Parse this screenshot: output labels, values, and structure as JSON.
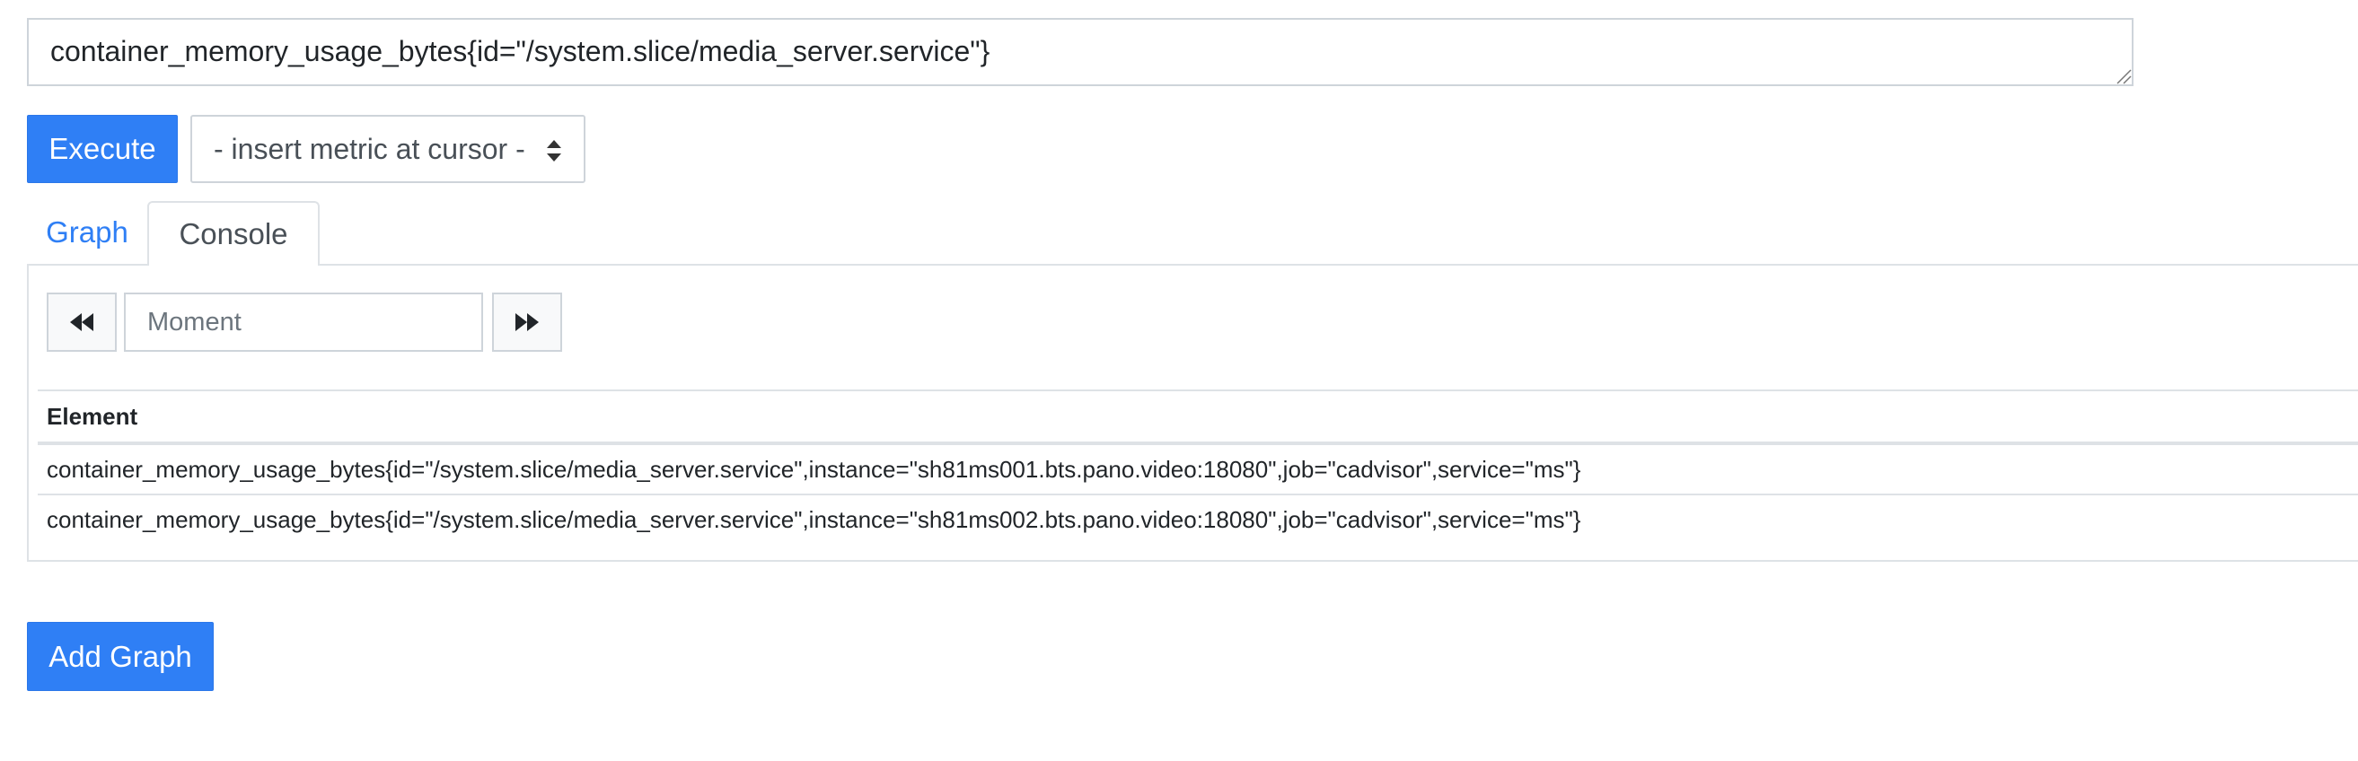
{
  "expression": {
    "value": "container_memory_usage_bytes{id=\"/system.slice/media_server.service\"}"
  },
  "toolbar": {
    "execute_label": "Execute",
    "metric_select_label": "- insert metric at cursor -"
  },
  "tabs": [
    {
      "label": "Graph",
      "active": false
    },
    {
      "label": "Console",
      "active": true
    }
  ],
  "console": {
    "moment_placeholder": "Moment",
    "prev_icon": "fast-backward-icon",
    "next_icon": "fast-forward-icon",
    "table": {
      "header": "Element",
      "rows": [
        "container_memory_usage_bytes{id=\"/system.slice/media_server.service\",instance=\"sh81ms001.bts.pano.video:18080\",job=\"cadvisor\",service=\"ms\"}",
        "container_memory_usage_bytes{id=\"/system.slice/media_server.service\",instance=\"sh81ms002.bts.pano.video:18080\",job=\"cadvisor\",service=\"ms\"}"
      ]
    }
  },
  "footer": {
    "add_graph_label": "Add Graph"
  },
  "colors": {
    "primary": "#2f7ff5",
    "border": "#ced4da",
    "text": "#212529"
  }
}
